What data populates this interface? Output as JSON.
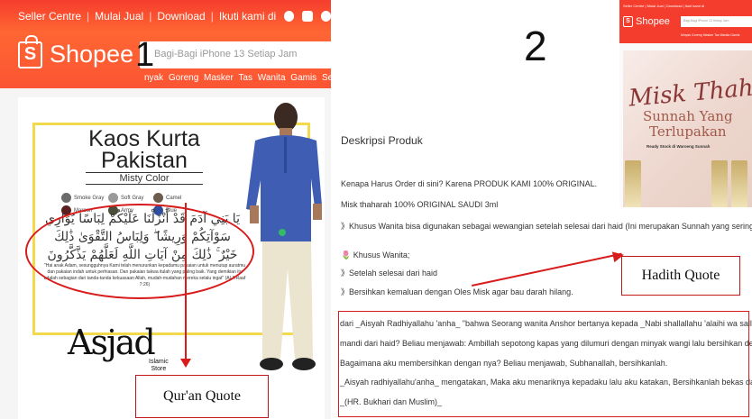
{
  "panel1": {
    "topbar": {
      "seller_centre": "Seller Centre",
      "mulai_jual": "Mulai Jual",
      "download": "Download",
      "ikuti": "Ikuti kami di",
      "separator": "|"
    },
    "logo_text": "Shopee",
    "logo_mark": "S",
    "search_placeholder": "Bagi-Bagi iPhone 13 Setiap Jam",
    "keywords": "nyak Goreng  Masker  Tas Wanita  Gamis  Ser",
    "figure_number": "1",
    "product_image": {
      "title_line1": "Kaos Kurta",
      "title_line2": "Pakistan",
      "subtitle": "Misty Color",
      "swatches": [
        {
          "label": "Smoke Gray",
          "color": "#6b6b6b"
        },
        {
          "label": "Soft Gray",
          "color": "#9a9a9a"
        },
        {
          "label": "Camel",
          "color": "#6d5c4c"
        },
        {
          "label": "Maroon",
          "color": "#5a2020"
        },
        {
          "label": "Army",
          "color": "#4a4f3a"
        },
        {
          "label": "Blue",
          "color": "#2e4d9c"
        }
      ],
      "arabic_text": "يَا بَنِي آدَمَ قَدْ أَنْزَلْنَا عَلَيْكُمْ لِبَاسًا يُوَارِي سَوْآتِكُمْ وَرِيشًا ۖ وَلِبَاسُ التَّقْوَىٰ ذَٰلِكَ خَيْرٌ ۚ ذَٰلِكَ مِنْ آيَاتِ اللَّهِ لَعَلَّهُمْ يَذَّكَّرُونَ",
      "translation": "\"Hai anak Adam, sesungguhnya Kami telah menurunkan kepadamu pakaian untuk menutup auratmu dan pakaian indah untuk perhiasan. Dan pakaian takwa itulah yang paling baik. Yang demikian itu adalah sebagian dari tanda-tanda kekuasaan Allah, mudah-mudahan mereka selalu ingat\" (Al-A'Raaf 7:26)",
      "brand": "Asjad",
      "brand_sub_line1": "Islamic",
      "brand_sub_line2": "Store"
    },
    "annotation": "Qur'an Quote"
  },
  "panel2": {
    "figure_number": "2",
    "section_title": "Deskripsi Produk",
    "lines": [
      "Kenapa Harus Order di sini? Karena PRODUK KAMI 100% ORIGINAL.",
      "Misk thaharah 100% ORIGINAL SAUDI 3ml",
      "》Khusus Wanita bisa digunakan sebagai wewangian setelah selesai dari haid (Ini merupakan Sunnah yang sering dilupakan).",
      "🌷 Khusus Wanita;",
      "》Setelah selesai dari haid",
      "》Bersihkan kemaluan dengan Oles Misk agar bau darah hilang."
    ],
    "hadith_lines": [
      "dari _Aisyah Radhiyallahu 'anha_ \"bahwa Seorang wanita Anshor bertanya kepada _Nabi shallallahu 'alaihi wa sallam_ : Bagaimana aku",
      "mandi dari haid? Beliau menjawab: Ambillah sepotong kapas yang dilumuri dengan minyak wangi lalu bersihkan dengan itu. Ia bertanya lagi:",
      "Bagaimana aku membersihkan dengan nya? Beliau menjawab, Subhanallah, bersihkanlah.",
      "_Aisyah radhiyallahu'anha_ mengatakan, Maka aku menariknya kepadaku lalu aku katakan, Bersihkanlah bekas darah dengannya..\"",
      "_(HR. Bukhari dan Muslim)_"
    ],
    "annotation": "Hadith Quote",
    "mini_screenshot": {
      "topbar": "Seller Centre | Mulai Jual | Download | Ikuti kami di",
      "logo_text": "Shopee",
      "search_placeholder": "Bagi-Bagi iPhone 13 Setiap Jam",
      "keywords": "Minyak Goreng  Masker  Tas Wanita  Gamis",
      "poster_title": "Misk Thaharah",
      "poster_sub1": "Sunnah Yang",
      "poster_sub2": "Terlupakan",
      "poster_ready": "Ready Stock di Waroeng Sunnah"
    }
  },
  "colors": {
    "shopee_orange": "#f53d2d",
    "annotation_red": "#d81b1b",
    "frame_yellow": "#f2d94e"
  }
}
